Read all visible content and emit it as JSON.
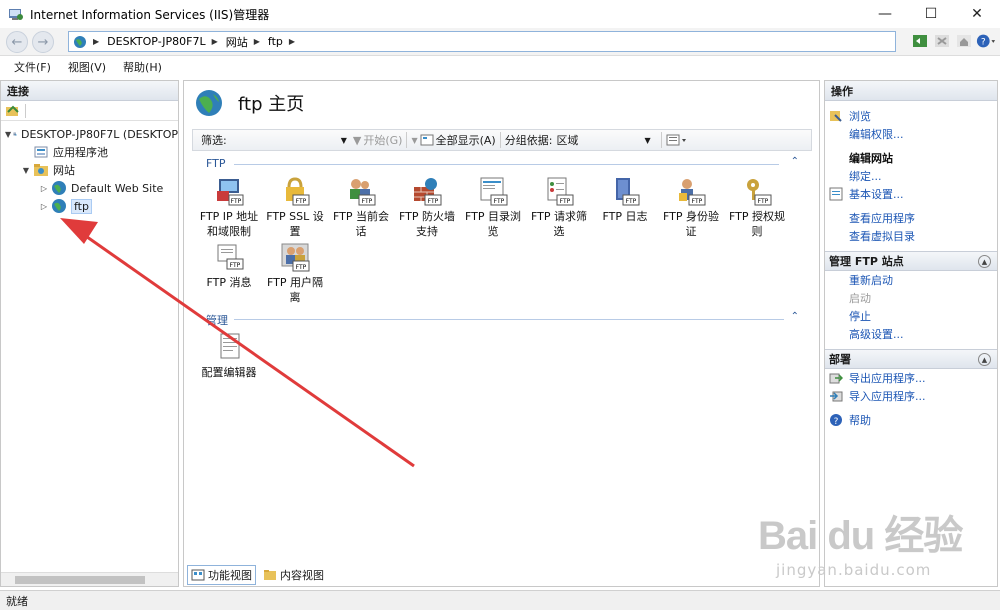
{
  "window": {
    "title": "Internet Information Services (IIS)管理器",
    "controls": {
      "minimize": "—",
      "maximize": "☐",
      "close": "✕"
    }
  },
  "address_bar": {
    "crumbs": [
      "DESKTOP-JP80F7L",
      "网站",
      "ftp"
    ]
  },
  "menu": [
    "文件(F)",
    "视图(V)",
    "帮助(H)"
  ],
  "connections": {
    "header": "连接",
    "tree": [
      {
        "label": "DESKTOP-JP80F7L (DESKTOP",
        "expanded": true,
        "icon": "server-icon"
      },
      {
        "label": "应用程序池",
        "icon": "app-pool-icon"
      },
      {
        "label": "网站",
        "expanded": true,
        "icon": "sites-folder-icon"
      },
      {
        "label": "Default Web Site",
        "icon": "globe-icon"
      },
      {
        "label": "ftp",
        "icon": "globe-icon",
        "selected": true
      }
    ]
  },
  "main": {
    "title": "ftp 主页",
    "filter": {
      "label": "筛选:",
      "start": "开始(G)",
      "show_all": "全部显示(A)",
      "group_by_label": "分组依据:",
      "group_by_value": "区域"
    },
    "sections": [
      {
        "title": "FTP",
        "features": [
          [
            "FTP IP 地址",
            "和域限制"
          ],
          [
            "FTP SSL 设",
            "置"
          ],
          [
            "FTP 当前会",
            "话"
          ],
          [
            "FTP 防火墙",
            "支持"
          ],
          [
            "FTP 目录浏",
            "览"
          ],
          [
            "FTP 请求筛",
            "选"
          ],
          [
            "FTP 日志",
            ""
          ],
          [
            "FTP 身份验",
            "证"
          ],
          [
            "FTP 授权规",
            "则"
          ],
          [
            "FTP 消息",
            ""
          ],
          [
            "FTP 用户隔",
            "离"
          ]
        ]
      },
      {
        "title": "管理",
        "features": [
          [
            "配置编辑器",
            ""
          ]
        ]
      }
    ],
    "tabs": [
      "功能视图",
      "内容视图"
    ]
  },
  "actions": {
    "header": "操作",
    "group1": [
      "浏览",
      "编辑权限..."
    ],
    "edit_site_label": "编辑网站",
    "group2": [
      "绑定...",
      "基本设置..."
    ],
    "group3": [
      "查看应用程序",
      "查看虚拟目录"
    ],
    "manage_ftp_header": "管理 FTP 站点",
    "manage_ftp": [
      {
        "label": "重新启动",
        "enabled": true
      },
      {
        "label": "启动",
        "enabled": false
      },
      {
        "label": "停止",
        "enabled": true
      },
      {
        "label": "高级设置...",
        "enabled": true
      }
    ],
    "deploy_header": "部署",
    "deploy": [
      "导出应用程序...",
      "导入应用程序..."
    ],
    "help": "帮助"
  },
  "status": {
    "text": "就绪"
  },
  "watermark": {
    "brand": "Bai du 经验",
    "url": "jingyan.baidu.com"
  },
  "colors": {
    "link": "#1c56b4",
    "annotation_arrow": "#e03b3b",
    "section": "#2b5797"
  }
}
